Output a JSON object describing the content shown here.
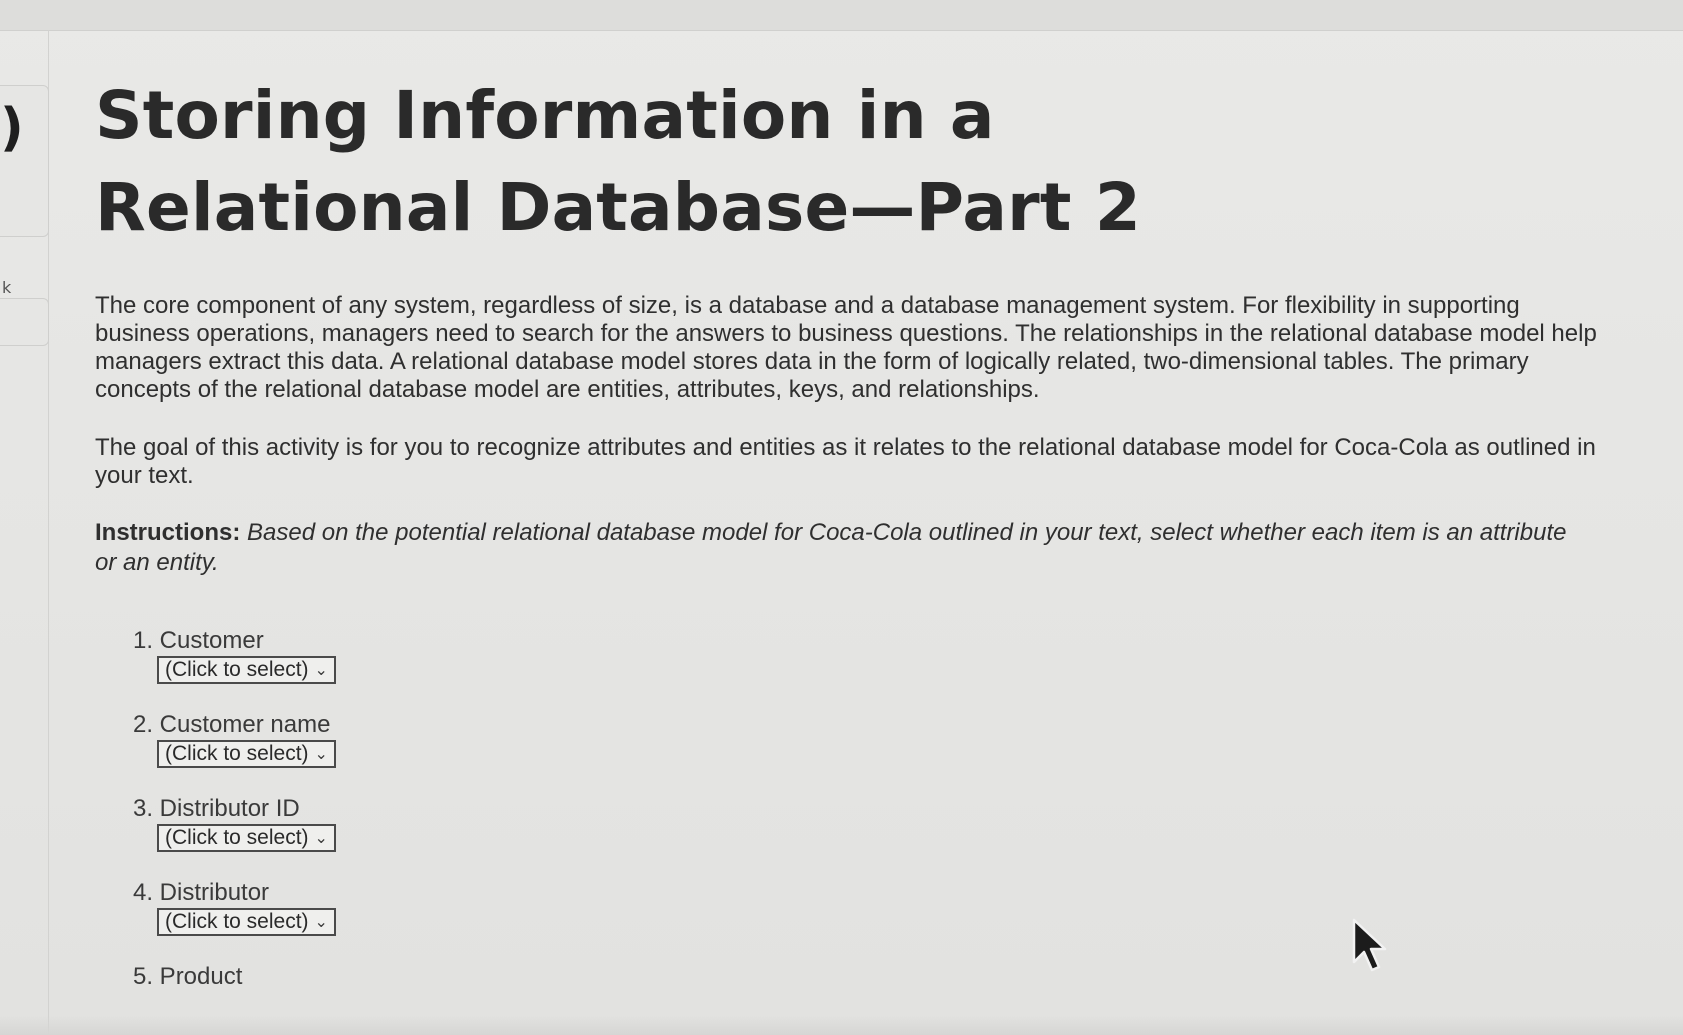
{
  "page": {
    "title": "Storing Information in a Relational Database—Part 2",
    "paragraphs": [
      "The core component of any system, regardless of size, is a database and a database management system. For flexibility in supporting business operations, managers need to search for the answers to business questions. The relationships in the relational database model help managers extract this data. A relational database model stores data in the form of logically related, two-dimensional tables. The primary concepts of the relational database model are entities, attributes, keys, and relationships.",
      "The goal of this activity is for you to recognize attributes and entities as it relates to the relational database model for Coca-Cola as outlined in your text."
    ],
    "instructions_label": "Instructions:",
    "instructions_text": "Based on the potential relational database model for Coca-Cola outlined in your text, select whether each item is an attribute or an entity."
  },
  "items": [
    {
      "label": "1. Customer",
      "select_value": "(Click to select)"
    },
    {
      "label": "2. Customer name",
      "select_value": "(Click to select)"
    },
    {
      "label": "3. Distributor ID",
      "select_value": "(Click to select)"
    },
    {
      "label": "4. Distributor",
      "select_value": "(Click to select)"
    },
    {
      "label": "5. Product"
    }
  ],
  "sidebar": {
    "glyph_top": ")",
    "glyph_bottom": "k"
  },
  "icons": {
    "dropdown": "chevron-down-icon",
    "pointer": "mouse-pointer-icon"
  }
}
